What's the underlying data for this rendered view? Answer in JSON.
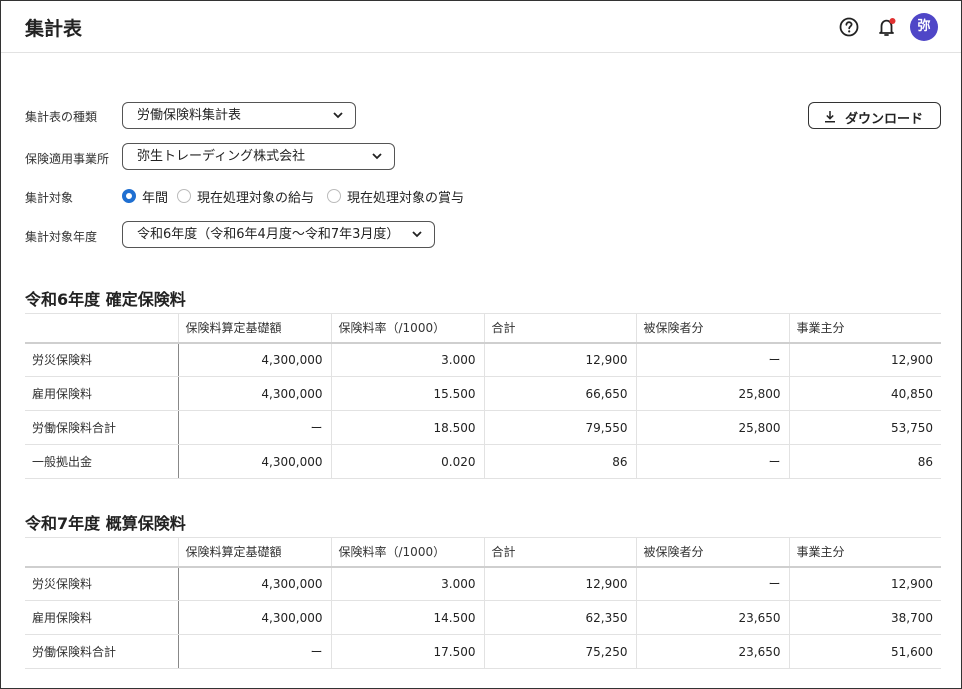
{
  "app": {
    "title": "集計表",
    "avatar_text": "弥",
    "accent_color": "#4f46c7",
    "icons": [
      "help-circle-icon",
      "bell-icon"
    ]
  },
  "form": {
    "type_label": "集計表の種類",
    "type_value": "労働保険料集計表",
    "office_label": "保険適用事業所",
    "office_value": "弥生トレーディング株式会社",
    "target_label": "集計対象",
    "target_options": [
      "年間",
      "現在処理対象の給与",
      "現在処理対象の賞与"
    ],
    "target_selected": "年間",
    "year_label": "集計対象年度",
    "year_value": "令和6年度（令和6年4月度〜令和7年3月度）",
    "download_label": "ダウンロード"
  },
  "sections": [
    {
      "title": "令和6年度 確定保険料",
      "headers": [
        "",
        "保険料算定基礎額",
        "保険料率（/1000）",
        "合計",
        "被保険者分",
        "事業主分"
      ],
      "rows": [
        [
          "労災保険料",
          "4,300,000",
          "3.000",
          "12,900",
          "ー",
          "12,900"
        ],
        [
          "雇用保険料",
          "4,300,000",
          "15.500",
          "66,650",
          "25,800",
          "40,850"
        ],
        [
          "労働保険料合計",
          "ー",
          "18.500",
          "79,550",
          "25,800",
          "53,750"
        ],
        [
          "一般拠出金",
          "4,300,000",
          "0.020",
          "86",
          "ー",
          "86"
        ]
      ]
    },
    {
      "title": "令和7年度 概算保険料",
      "headers": [
        "",
        "保険料算定基礎額",
        "保険料率（/1000）",
        "合計",
        "被保険者分",
        "事業主分"
      ],
      "rows": [
        [
          "労災保険料",
          "4,300,000",
          "3.000",
          "12,900",
          "ー",
          "12,900"
        ],
        [
          "雇用保険料",
          "4,300,000",
          "14.500",
          "62,350",
          "23,650",
          "38,700"
        ],
        [
          "労働保険料合計",
          "ー",
          "17.500",
          "75,250",
          "23,650",
          "51,600"
        ]
      ]
    }
  ]
}
